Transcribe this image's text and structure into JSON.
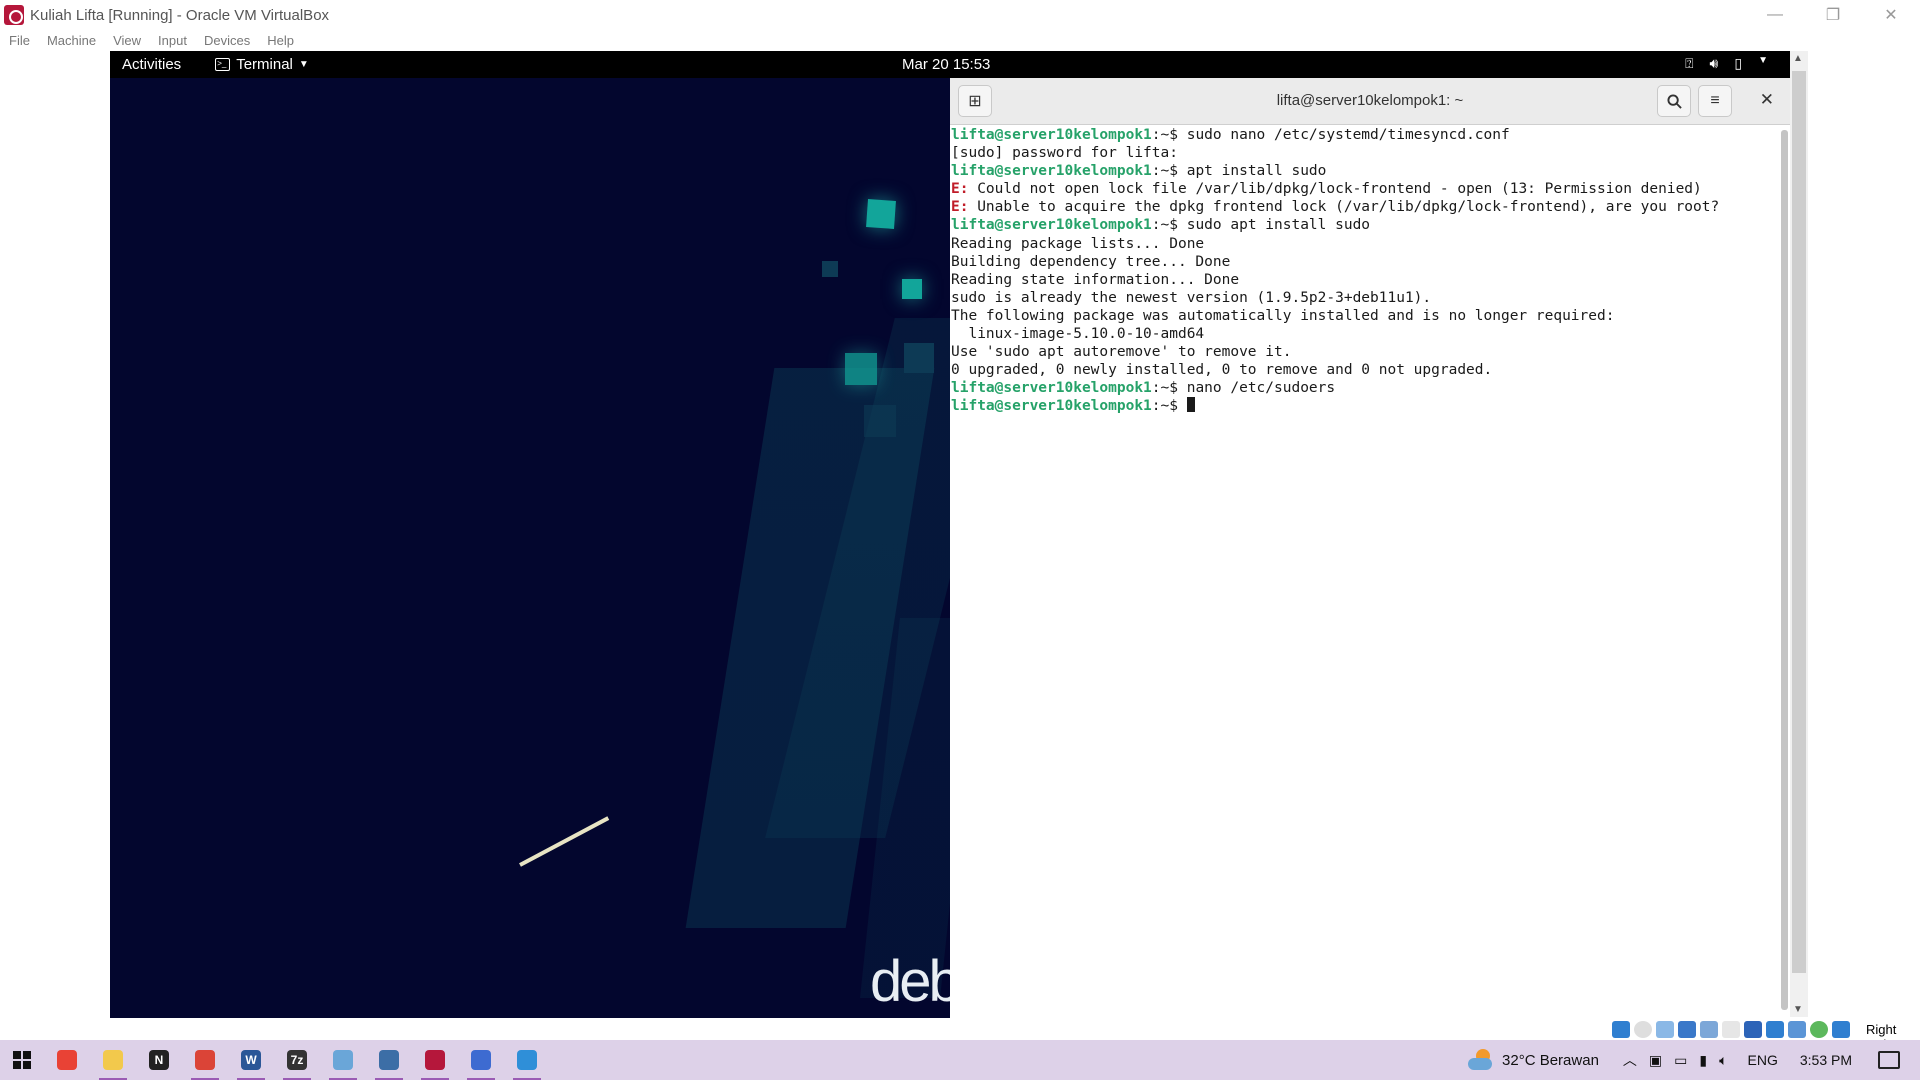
{
  "window": {
    "title": "Kuliah Lifta [Running] - Oracle VM VirtualBox",
    "controls": [
      "—",
      "❐",
      "✕"
    ]
  },
  "vb_menu": [
    "File",
    "Machine",
    "View",
    "Input",
    "Devices",
    "Help"
  ],
  "gnome": {
    "activities": "Activities",
    "app_menu": "Terminal",
    "clock": "Mar 20  15:53",
    "tray_icons": [
      "accessibility-icon",
      "volume-icon",
      "battery-icon",
      "menu-arrow-icon"
    ]
  },
  "wallpaper": {
    "logo_text": "deb"
  },
  "terminal": {
    "title": "lifta@server10kelompok1: ~",
    "lines": [
      {
        "prompt": "lifta@server10kelompok1",
        "cmd": ":~$ sudo nano /etc/systemd/timesyncd.conf"
      },
      {
        "text": "[sudo] password for lifta:"
      },
      {
        "prompt": "lifta@server10kelompok1",
        "cmd": ":~$ apt install sudo"
      },
      {
        "err": "E:",
        "text": " Could not open lock file /var/lib/dpkg/lock-frontend - open (13: Permission denied)"
      },
      {
        "err": "E:",
        "text": " Unable to acquire the dpkg frontend lock (/var/lib/dpkg/lock-frontend), are you root?"
      },
      {
        "prompt": "lifta@server10kelompok1",
        "cmd": ":~$ sudo apt install sudo"
      },
      {
        "text": "Reading package lists... Done"
      },
      {
        "text": "Building dependency tree... Done"
      },
      {
        "text": "Reading state information... Done"
      },
      {
        "text": "sudo is already the newest version (1.9.5p2-3+deb11u1)."
      },
      {
        "text": "The following package was automatically installed and is no longer required:"
      },
      {
        "text": "  linux-image-5.10.0-10-amd64"
      },
      {
        "text": "Use 'sudo apt autoremove' to remove it."
      },
      {
        "text": "0 upgraded, 0 newly installed, 0 to remove and 0 not upgraded."
      },
      {
        "prompt": "lifta@server10kelompok1",
        "cmd": ":~$ nano /etc/sudoers"
      },
      {
        "prompt": "lifta@server10kelompok1",
        "cmd": ":~$ "
      }
    ]
  },
  "vb_status": {
    "host_key": "Right Ctrl"
  },
  "taskbar": {
    "apps": [
      {
        "name": "chrome-icon",
        "color": "#e94235",
        "label": "",
        "active": false
      },
      {
        "name": "file-explorer-icon",
        "color": "#f2c94c",
        "label": "",
        "active": true
      },
      {
        "name": "notion-icon",
        "color": "#222222",
        "label": "N",
        "active": false
      },
      {
        "name": "chrome-profile-icon",
        "color": "#db4437",
        "label": "",
        "active": true
      },
      {
        "name": "word-icon",
        "color": "#2b5797",
        "label": "W",
        "active": true
      },
      {
        "name": "7zip-icon",
        "color": "#333333",
        "label": "7z",
        "active": true
      },
      {
        "name": "paint-icon",
        "color": "#6aa6d8",
        "label": "",
        "active": true
      },
      {
        "name": "virtualbox-icon",
        "color": "#3c6ea6",
        "label": "",
        "active": true
      },
      {
        "name": "virtualbox-vm-icon",
        "color": "#b5173b",
        "label": "",
        "active": true
      },
      {
        "name": "app-icon",
        "color": "#3d6bd1",
        "label": "",
        "active": true
      },
      {
        "name": "photos-icon",
        "color": "#2f8fd8",
        "label": "",
        "active": true
      }
    ],
    "weather": "32°C  Berawan",
    "lang": "ENG",
    "time": "3:53 PM"
  }
}
